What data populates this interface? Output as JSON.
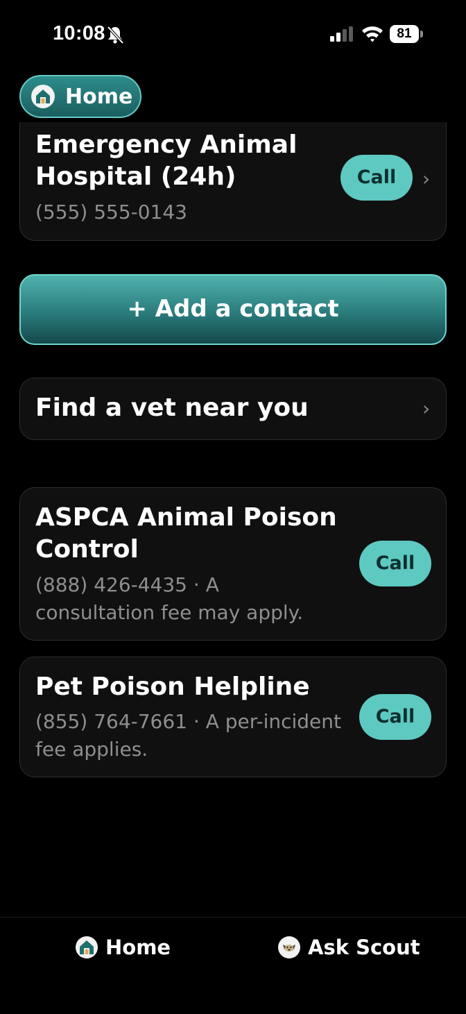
{
  "status_bar": {
    "time": "10:08",
    "battery": "81"
  },
  "header": {
    "home_label": "Home"
  },
  "contacts": {
    "emergency": {
      "title": "Emergency Animal Hospital (24h)",
      "phone": "(555) 555-0143",
      "call_label": "Call"
    },
    "add_contact_label": "+ Add a contact",
    "find_vet_label": "Find a vet near you",
    "aspca": {
      "title": "ASPCA Animal Poison Control",
      "detail": "(888) 426-4435 · A consultation fee may apply.",
      "call_label": "Call"
    },
    "pet_poison": {
      "title": "Pet Poison Helpline",
      "detail": "(855) 764-7661 · A per-incident fee applies.",
      "call_label": "Call"
    }
  },
  "bottom_nav": {
    "home_label": "Home",
    "scout_label": "Ask Scout"
  },
  "colors": {
    "accent": "#5ec9c1",
    "background": "#000000",
    "card": "#101010"
  }
}
